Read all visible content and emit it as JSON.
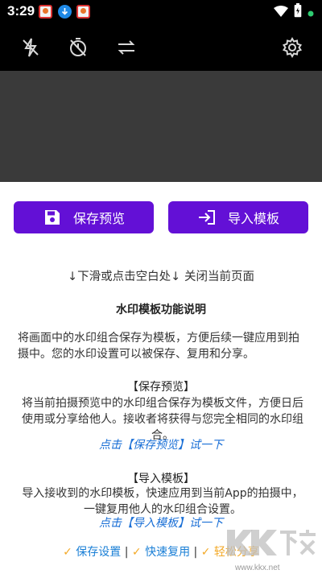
{
  "status_bar": {
    "time": "3:29",
    "notification_icons": [
      "photo-app-icon",
      "download-icon",
      "photo-app-icon"
    ]
  },
  "toolbar": {
    "icons": [
      "flash-off-icon",
      "timer-off-icon",
      "switch-camera-icon",
      "settings-icon"
    ]
  },
  "actions": {
    "save_label": "保存预览",
    "import_label": "导入模板"
  },
  "hint": "↓下滑或点击空白处↓ 关闭当前页面",
  "explanation": {
    "title": "水印模板功能说明",
    "intro": "将画面中的水印组合保存为模板，方便后续一键应用到拍摄中。您的水印设置可以被保存、复用和分享。",
    "save_section": {
      "title": "【保存预览】",
      "body": "将当前拍摄预览中的水印组合保存为模板文件，方便日后使用或分享给他人。接收者将获得与您完全相同的水印组合。",
      "link": "点击【保存预览】试一下"
    },
    "import_section": {
      "title": "【导入模板】",
      "body": "导入接收到的水印模板，快速应用到当前App的拍摄中，一键复用他人的水印组合设置。",
      "link": "点击【导入模板】试一下"
    }
  },
  "features": {
    "check": "✓",
    "sep": "|",
    "items": [
      "保存设置",
      "快速复用",
      "轻松分享"
    ]
  },
  "watermark": {
    "logo_text": "KK下载",
    "url": "www.kkx.net"
  },
  "colors": {
    "accent": "#6310d6",
    "link": "#1a6fd6",
    "check": "#f3a928"
  }
}
